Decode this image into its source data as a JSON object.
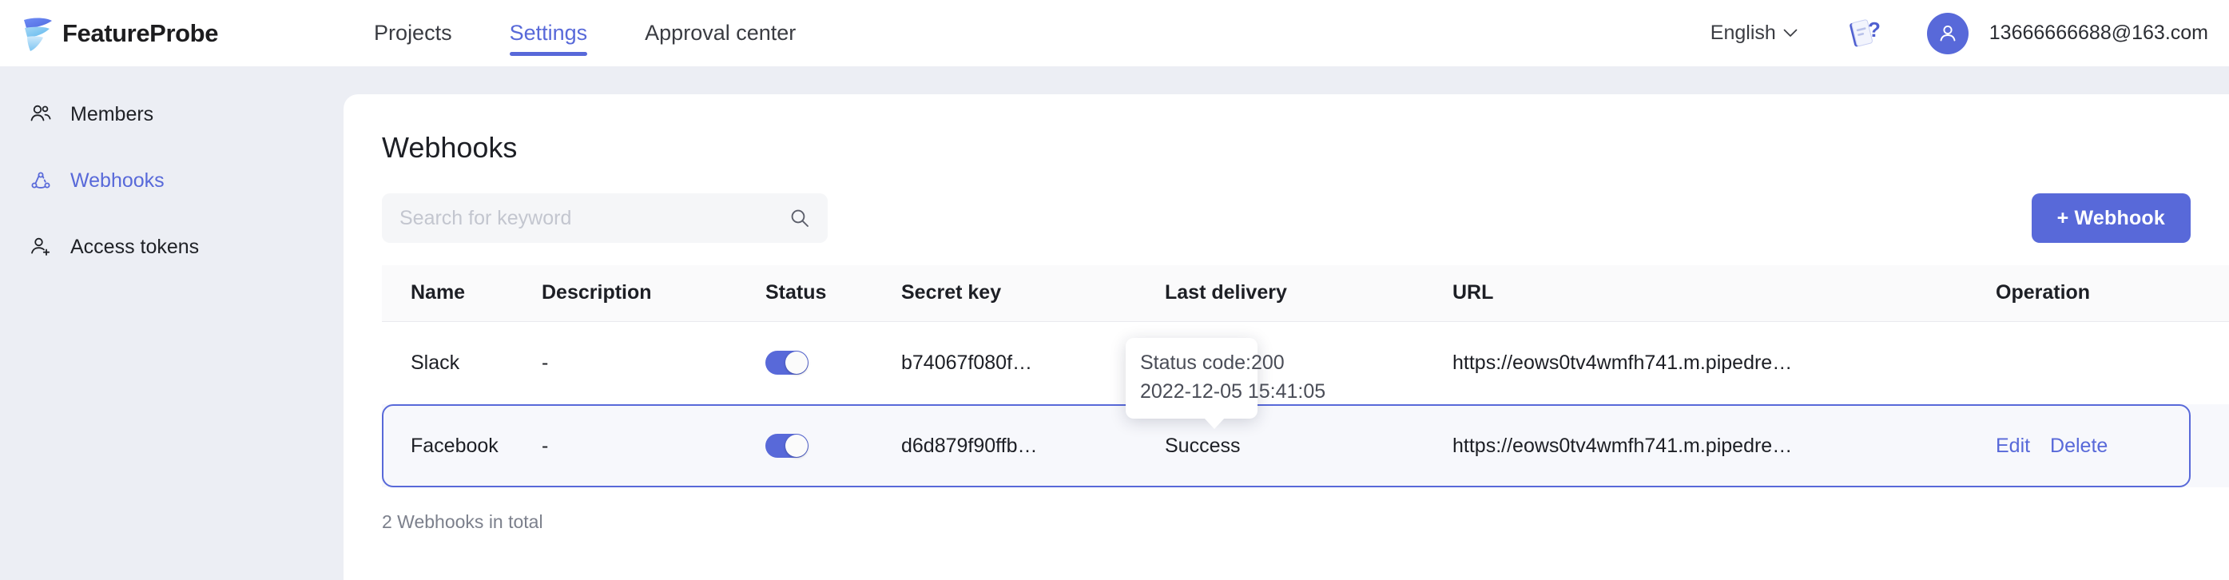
{
  "brand": {
    "name": "FeatureProbe",
    "logo_icon": "featureprobe-logo-icon"
  },
  "topnav": {
    "items": [
      {
        "label": "Projects",
        "active": false
      },
      {
        "label": "Settings",
        "active": true
      },
      {
        "label": "Approval center",
        "active": false
      }
    ],
    "language": "English",
    "language_chevron_icon": "chevron-down-icon",
    "help_icon": "help-doc-icon",
    "avatar_icon": "user-avatar-icon",
    "user_email": "13666666688@163.com"
  },
  "sidebar": {
    "items": [
      {
        "label": "Members",
        "icon": "members-icon",
        "active": false
      },
      {
        "label": "Webhooks",
        "icon": "webhooks-icon",
        "active": true
      },
      {
        "label": "Access tokens",
        "icon": "access-token-icon",
        "active": false
      }
    ]
  },
  "main": {
    "title": "Webhooks",
    "search": {
      "placeholder": "Search for keyword",
      "value": "",
      "icon": "search-icon"
    },
    "add_button": {
      "label": "+ Webhook"
    },
    "table": {
      "columns": [
        "Name",
        "Description",
        "Status",
        "Secret key",
        "Last delivery",
        "URL",
        "Operation"
      ],
      "rows": [
        {
          "name": "Slack",
          "description": "-",
          "status_enabled": true,
          "secret_key": "b74067f080f…",
          "last_delivery": "",
          "url": "https://eows0tv4wmfh741.m.pipedre…",
          "operations": [],
          "highlighted": false
        },
        {
          "name": "Facebook",
          "description": "-",
          "status_enabled": true,
          "secret_key": "d6d879f90ffb…",
          "last_delivery": "Success",
          "url": "https://eows0tv4wmfh741.m.pipedre…",
          "operations": [
            "Edit",
            "Delete"
          ],
          "highlighted": true
        }
      ]
    },
    "total_text": "2 Webhooks in total"
  },
  "tooltip": {
    "line1": "Status code:200",
    "line2": "2022-12-05 15:41:05"
  },
  "colors": {
    "accent": "#5869d9",
    "page_bg": "#eceef4",
    "card_bg": "#ffffff",
    "table_header_bg": "#fafafb",
    "highlight_row_bg": "#f7f8fc",
    "muted_text": "#7c808c"
  }
}
